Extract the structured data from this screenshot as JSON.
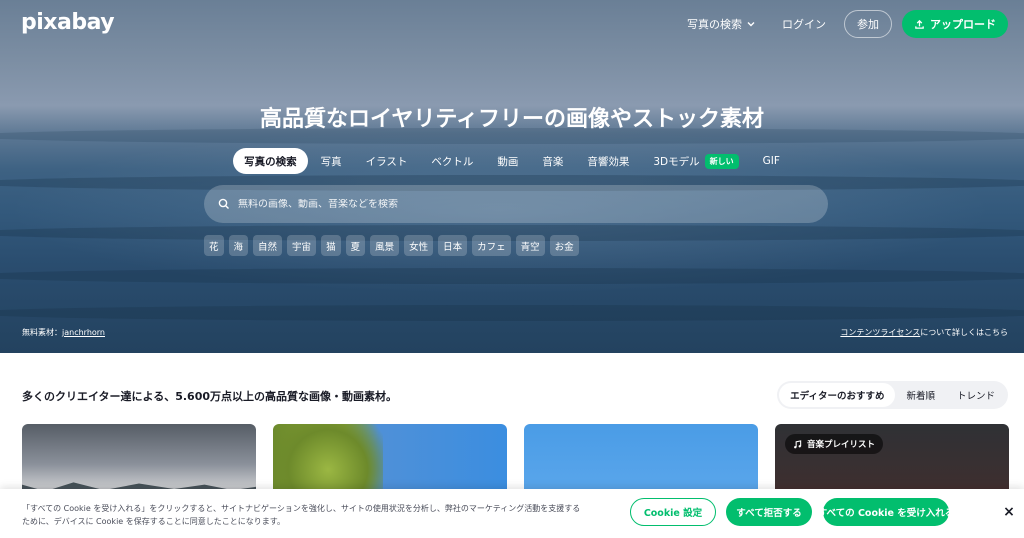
{
  "brand": {
    "logo_text": "pixabay",
    "accent_color": "#02be6e"
  },
  "topnav": {
    "search_type_dropdown": "写真の検索",
    "login": "ログイン",
    "join": "参加",
    "upload": "アップロード"
  },
  "hero": {
    "headline": "高品質なロイヤリティフリーの画像やストック素材",
    "tabs": [
      {
        "label": "写真の検索",
        "active": true
      },
      {
        "label": "写真"
      },
      {
        "label": "イラスト"
      },
      {
        "label": "ベクトル"
      },
      {
        "label": "動画"
      },
      {
        "label": "音楽"
      },
      {
        "label": "音響効果"
      },
      {
        "label": "3Dモデル",
        "badge": "新しい"
      },
      {
        "label": "GIF"
      }
    ],
    "search_placeholder": "無料の画像、動画、音楽などを検索",
    "chips": [
      "花",
      "海",
      "自然",
      "宇宙",
      "猫",
      "夏",
      "風景",
      "女性",
      "日本",
      "カフェ",
      "青空",
      "お金"
    ],
    "credit_prefix": "無料素材：",
    "credit_author": "janchrhorn",
    "license_link": "コンテンツライセンス",
    "license_suffix": "について詳しくはこちら"
  },
  "main": {
    "tagline": "多くのクリエイター達による、5.600万点以上の高品質な画像・動画素材。",
    "sort_tabs": [
      {
        "label": "エディターのおすすめ",
        "active": true
      },
      {
        "label": "新着順"
      },
      {
        "label": "トレンド"
      }
    ],
    "playlist_label": "音楽プレイリスト"
  },
  "cookie": {
    "text": "「すべての Cookie を受け入れる」をクリックすると、サイトナビゲーションを強化し、サイトの使用状況を分析し、弊社のマーケティング活動を支援するために、デバイスに Cookie を保存することに同意したことになります。",
    "settings": "Cookie 設定",
    "reject": "すべて拒否する",
    "accept": "すべての Cookie を受け入れる",
    "close": "×"
  }
}
